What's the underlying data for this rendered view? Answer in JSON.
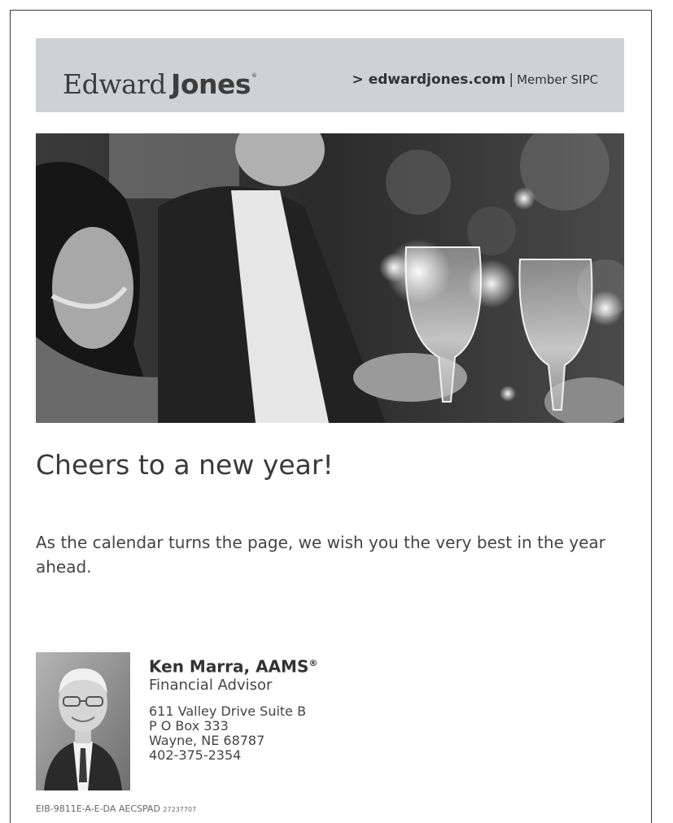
{
  "brand": {
    "name_part1": "Edward",
    "name_part2": "Jones",
    "reg_mark": "®",
    "link_text": "> edwardjones.com",
    "separator": "|",
    "member_text": "Member SIPC"
  },
  "headline": "Cheers to a new year!",
  "message": "As the calendar turns the page, we wish you the very best in the year ahead.",
  "advisor": {
    "name": "Ken Marra, AAMS",
    "name_mark": "®",
    "title": "Financial Advisor",
    "address_lines": [
      "611 Valley Drive Suite B",
      "P O Box 333",
      "Wayne, NE 68787",
      "402-375-2354"
    ]
  },
  "footer": {
    "code": "EIB-9811E-A-E-DA AECSPAD",
    "code_small": "27237707"
  }
}
